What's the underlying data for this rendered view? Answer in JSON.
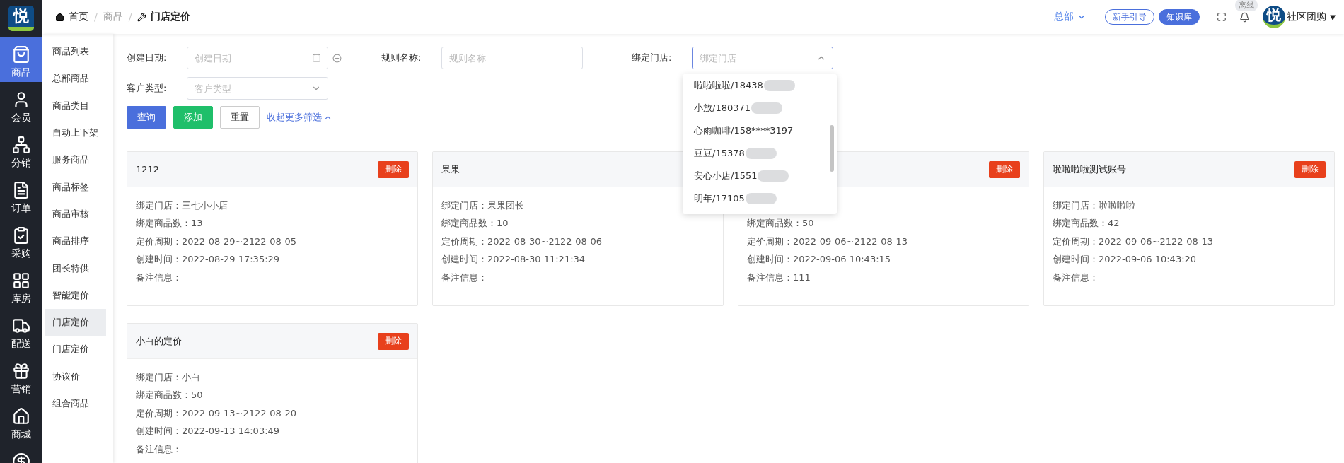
{
  "logo": {
    "glyph": "悦"
  },
  "breadcrumb": [
    {
      "label": "首页",
      "kind": "home"
    },
    {
      "label": "商品",
      "kind": "plain",
      "separator": "/"
    },
    {
      "label": "门店定价",
      "kind": "current",
      "separator": "/"
    }
  ],
  "header": {
    "org": "总部",
    "guide_button": "新手引导",
    "kb_button": "知识库",
    "status_badge": "离线",
    "avatar_glyph": "悦",
    "user": "社区团购",
    "user_caret": "▼"
  },
  "nav": [
    {
      "label": "商品",
      "selected": true
    },
    {
      "label": "会员",
      "selected": false
    },
    {
      "label": "分销",
      "selected": false
    },
    {
      "label": "订单",
      "selected": false
    },
    {
      "label": "采购",
      "selected": false
    },
    {
      "label": "库房",
      "selected": false
    },
    {
      "label": "配送",
      "selected": false
    },
    {
      "label": "营销",
      "selected": false
    },
    {
      "label": "商城",
      "selected": false
    },
    {
      "selected": false
    }
  ],
  "submenu": [
    {
      "label": "商品列表",
      "selected": false
    },
    {
      "label": "总部商品",
      "selected": false
    },
    {
      "label": "商品类目",
      "selected": false
    },
    {
      "label": "自动上下架",
      "selected": false
    },
    {
      "label": "服务商品",
      "selected": false
    },
    {
      "label": "商品标签",
      "selected": false
    },
    {
      "label": "商品审核",
      "selected": false
    },
    {
      "label": "商品排序",
      "selected": false
    },
    {
      "label": "团长特供",
      "selected": false
    },
    {
      "label": "智能定价",
      "selected": false
    },
    {
      "label": "门店定价",
      "selected": true
    },
    {
      "label": "门店定价",
      "selected": false
    },
    {
      "label": "协议价",
      "selected": false
    },
    {
      "label": "组合商品",
      "selected": false
    }
  ],
  "filters": {
    "date": {
      "label": "创建日期:",
      "placeholder": "创建日期"
    },
    "rule": {
      "label": "规则名称:",
      "placeholder": "规则名称"
    },
    "store": {
      "label": "绑定门店:",
      "placeholder": "绑定门店",
      "expanded": true
    },
    "customer": {
      "label": "客户类型:",
      "placeholder": "客户类型"
    }
  },
  "buttons": {
    "query": "查询",
    "add": "添加",
    "reset": "重置",
    "collapse": "收起更多筛选"
  },
  "store_options": [
    {
      "label": "啦啦啦啦/18438",
      "masked": true
    },
    {
      "label": "小放/180371",
      "masked": true
    },
    {
      "label": "心雨咖啡/158****3197",
      "masked": false
    },
    {
      "label": "豆豆/15378",
      "masked": true
    },
    {
      "label": "安心小店/1551",
      "masked": true
    },
    {
      "label": "明年/17105",
      "masked": true
    }
  ],
  "cards": [
    {
      "title": "1212",
      "delete": "删除",
      "fields": {
        "store": {
          "label": "绑定门店：",
          "value": "三七小小店"
        },
        "count": {
          "label": "绑定商品数：",
          "value": "13"
        },
        "period": {
          "label": "定价周期：",
          "value": "2022-08-29~2122-08-05"
        },
        "created": {
          "label": "创建时间：",
          "value": "2022-08-29 17:35:29"
        },
        "note": {
          "label": "备注信息："
        }
      }
    },
    {
      "title": "果果",
      "fields": {
        "store": {
          "label": "绑定门店：",
          "value": "果果团长"
        },
        "count": {
          "label": "绑定商品数：",
          "value": "10"
        },
        "period": {
          "label": "定价周期：",
          "value": "2022-08-30~2122-08-06"
        },
        "created": {
          "label": "创建时间：",
          "value": "2022-08-30 11:21:34"
        },
        "note": {
          "label": "备注信息："
        }
      }
    },
    {
      "delete": "删除",
      "fields": {
        "count": {
          "label": "绑定商品数：",
          "value": "50"
        },
        "period": {
          "label": "定价周期：",
          "value": "2022-09-06~2122-08-13"
        },
        "created": {
          "label": "创建时间：",
          "value": "2022-09-06 10:43:15"
        },
        "note": {
          "label": "备注信息：",
          "value": "111"
        }
      }
    },
    {
      "title": "啦啦啦啦测试账号",
      "delete": "删除",
      "fields": {
        "store": {
          "label": "绑定门店：",
          "value": "啦啦啦啦"
        },
        "count": {
          "label": "绑定商品数：",
          "value": "42"
        },
        "period": {
          "label": "定价周期：",
          "value": "2022-09-06~2122-08-13"
        },
        "created": {
          "label": "创建时间：",
          "value": "2022-09-06 10:43:20"
        },
        "note": {
          "label": "备注信息："
        }
      }
    },
    {
      "title": "小白的定价",
      "delete": "删除",
      "fields": {
        "store": {
          "label": "绑定门店：",
          "value": "小白"
        },
        "count": {
          "label": "绑定商品数：",
          "value": "50"
        },
        "period": {
          "label": "定价周期：",
          "value": "2022-09-13~2122-08-20"
        },
        "created": {
          "label": "创建时间：",
          "value": "2022-09-13 14:03:49"
        },
        "note": {
          "label": "备注信息："
        }
      }
    }
  ]
}
